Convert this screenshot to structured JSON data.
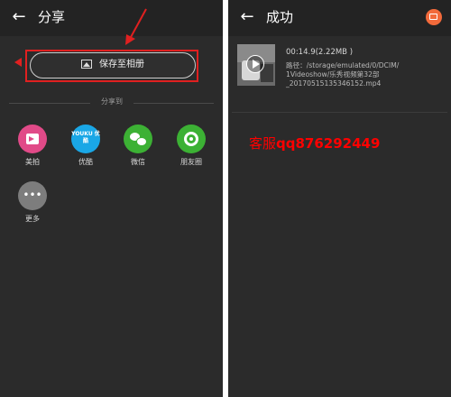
{
  "left": {
    "header": {
      "title": "分享"
    },
    "save_button": {
      "label": "保存至相册"
    },
    "divider_label": "分享到",
    "share_targets": [
      {
        "label": "美拍",
        "icon": "meipai-icon",
        "color": "#e14a88"
      },
      {
        "label": "优酷",
        "icon": "youku-icon",
        "color": "#1aa7e6",
        "logo_text": "YOUKU 优酷"
      },
      {
        "label": "微信",
        "icon": "wechat-icon",
        "color": "#3cb134"
      },
      {
        "label": "朋友圈",
        "icon": "moments-icon",
        "color": "#3cb134"
      },
      {
        "label": "更多",
        "icon": "more-icon",
        "color": "#7d7d7d"
      }
    ]
  },
  "right": {
    "header": {
      "title": "成功"
    },
    "video": {
      "duration": "00:14.9(2.22MB )",
      "path_lines": [
        "路径：/storage/emulated/0/DCIM/",
        "1Videoshow/乐秀视频第32部",
        "_20170515135346152.mp4"
      ]
    },
    "contact": {
      "prefix": "客服",
      "id": "qq876292449"
    }
  },
  "colors": {
    "background": "#2b2b2b",
    "header": "#232323",
    "annotation_red": "#e02020",
    "share_accent": "#f26a3b"
  }
}
